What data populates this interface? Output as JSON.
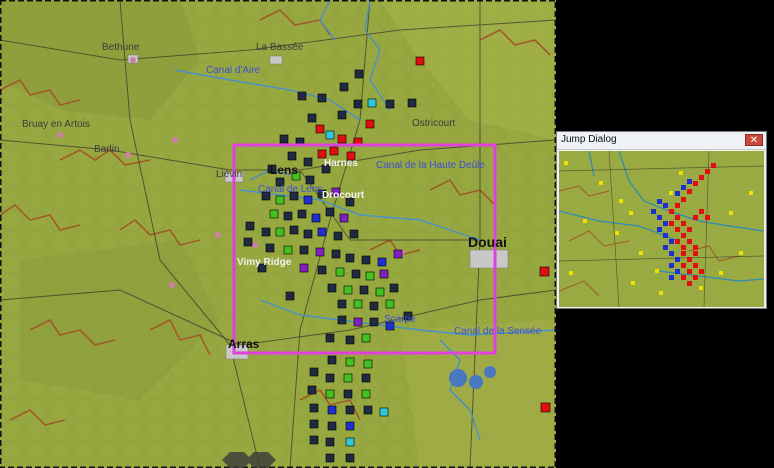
{
  "map": {
    "labels": {
      "bethune": "Bethune",
      "la_bassee": "La Bassée",
      "canal_aire": "Canal d'Aire",
      "bruay": "Bruay en Artois",
      "barlin": "Barlin",
      "lievin": "Liévin",
      "lens": "Lens",
      "canal_lens": "Canal de Lens",
      "harnes": "Harnes",
      "drocourt": "Drocourt",
      "oisnicourt": "Ostricourt",
      "canal_haute_deule": "Canal de la Haute Deûle",
      "douai": "Douai",
      "vimy_ridge": "Vimy Ridge",
      "scarpe": "Scarpe",
      "canal_sensee": "Canal de la Sensée",
      "arras": "Arras"
    },
    "colors": {
      "terrain": "#98a840",
      "terrain_dark": "#8a9a3a",
      "hexside": "#a05a2a",
      "river": "#4a90c8",
      "viewport_box": "#e040e0",
      "unit_red": "#e01010",
      "unit_green": "#44c020",
      "unit_blue": "#2030d0",
      "unit_yellow": "#f0e000"
    }
  },
  "dialog": {
    "title": "Jump Dialog",
    "close_icon": "close-icon"
  }
}
